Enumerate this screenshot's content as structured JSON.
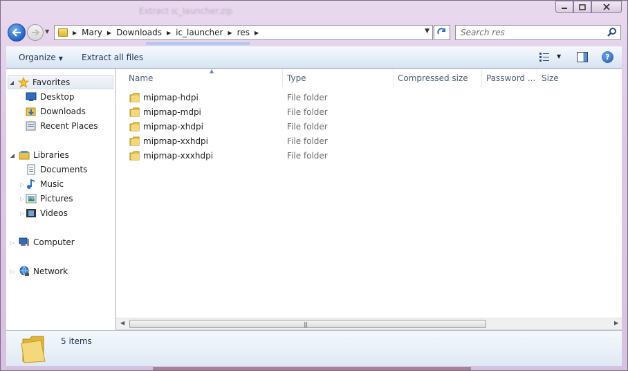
{
  "window": {
    "title": "Extract ic_launcher.zip",
    "controls": {
      "minimize": "minimize",
      "maximize": "maximize",
      "close": "close"
    }
  },
  "address_bar": {
    "breadcrumbs": [
      "Mary",
      "Downloads",
      "ic_launcher",
      "res"
    ]
  },
  "search": {
    "placeholder": "Search res"
  },
  "toolbar": {
    "organize_label": "Organize",
    "extract_label": "Extract all files"
  },
  "nav_pane": {
    "favorites": {
      "label": "Favorites",
      "items": [
        "Desktop",
        "Downloads",
        "Recent Places"
      ]
    },
    "libraries": {
      "label": "Libraries",
      "items": [
        "Documents",
        "Music",
        "Pictures",
        "Videos"
      ]
    },
    "computer": "Computer",
    "network": "Network"
  },
  "columns": [
    "Name",
    "Type",
    "Compressed size",
    "Password ...",
    "Size"
  ],
  "files": [
    {
      "name": "mipmap-hdpi",
      "type": "File folder"
    },
    {
      "name": "mipmap-mdpi",
      "type": "File folder"
    },
    {
      "name": "mipmap-xhdpi",
      "type": "File folder"
    },
    {
      "name": "mipmap-xxhdpi",
      "type": "File folder"
    },
    {
      "name": "mipmap-xxxhdpi",
      "type": "File folder"
    }
  ],
  "details": {
    "item_count": "5 items"
  },
  "colors": {
    "accent": "#1f62c5",
    "folder": "#e8c24a",
    "frame": "#dcc7e6"
  }
}
